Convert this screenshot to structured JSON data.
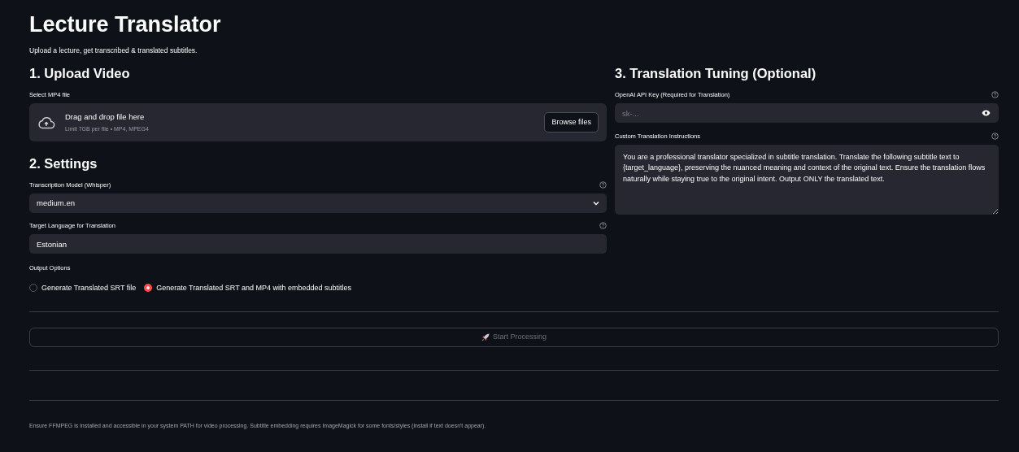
{
  "title": "Lecture Translator",
  "subtitle": "Upload a lecture, get transcribed & translated subtitles.",
  "upload": {
    "heading": "1. Upload Video",
    "label": "Select MP4 file",
    "drop_text": "Drag and drop file here",
    "limit_text": "Limit 7GB per file • MP4, MPEG4",
    "browse_button": "Browse files"
  },
  "settings": {
    "heading": "2. Settings",
    "model": {
      "label": "Transcription Model (Whisper)",
      "value": "medium.en"
    },
    "language": {
      "label": "Target Language for Translation",
      "value": "Estonian"
    },
    "output_label": "Output Options",
    "output_options": [
      {
        "label": "Generate Translated SRT file",
        "selected": false
      },
      {
        "label": "Generate Translated SRT and MP4 with embedded subtitles",
        "selected": true
      }
    ]
  },
  "tuning": {
    "heading": "3. Translation Tuning (Optional)",
    "api_key": {
      "label": "OpenAI API Key (Required for Translation)",
      "placeholder": "sk-..."
    },
    "instructions": {
      "label": "Custom Translation Instructions",
      "value": "You are a professional translator specialized in subtitle translation. Translate the following subtitle text to {target_language}, preserving the nuanced meaning and context of the original text. Ensure the translation flows naturally while staying true to the original intent. Output ONLY the translated text."
    }
  },
  "start_button": {
    "label": "Start Processing",
    "disabled": true
  },
  "footer": "Ensure FFMPEG is installed and accessible in your system PATH for video processing. Subtitle embedding requires ImageMagick for some fonts/styles (install if text doesn't appear)."
}
